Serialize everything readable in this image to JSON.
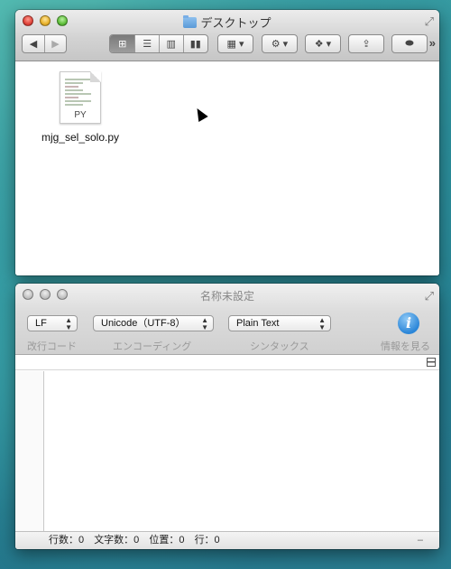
{
  "finder": {
    "title": "デスクトップ",
    "file": {
      "name": "mjg_sel_solo.py",
      "ext": "PY"
    }
  },
  "editor": {
    "title": "名称未設定",
    "line_ending": {
      "value": "LF",
      "label": "改行コード"
    },
    "encoding": {
      "value": "Unicode（UTF-8）",
      "label": "エンコーディング"
    },
    "syntax": {
      "value": "Plain Text",
      "label": "シンタックス"
    },
    "info": {
      "label": "情報を見る"
    },
    "status": {
      "lines": "行数：0",
      "chars": "文字数：0",
      "position": "位置：0",
      "row": "行：0",
      "dash": "–"
    }
  }
}
